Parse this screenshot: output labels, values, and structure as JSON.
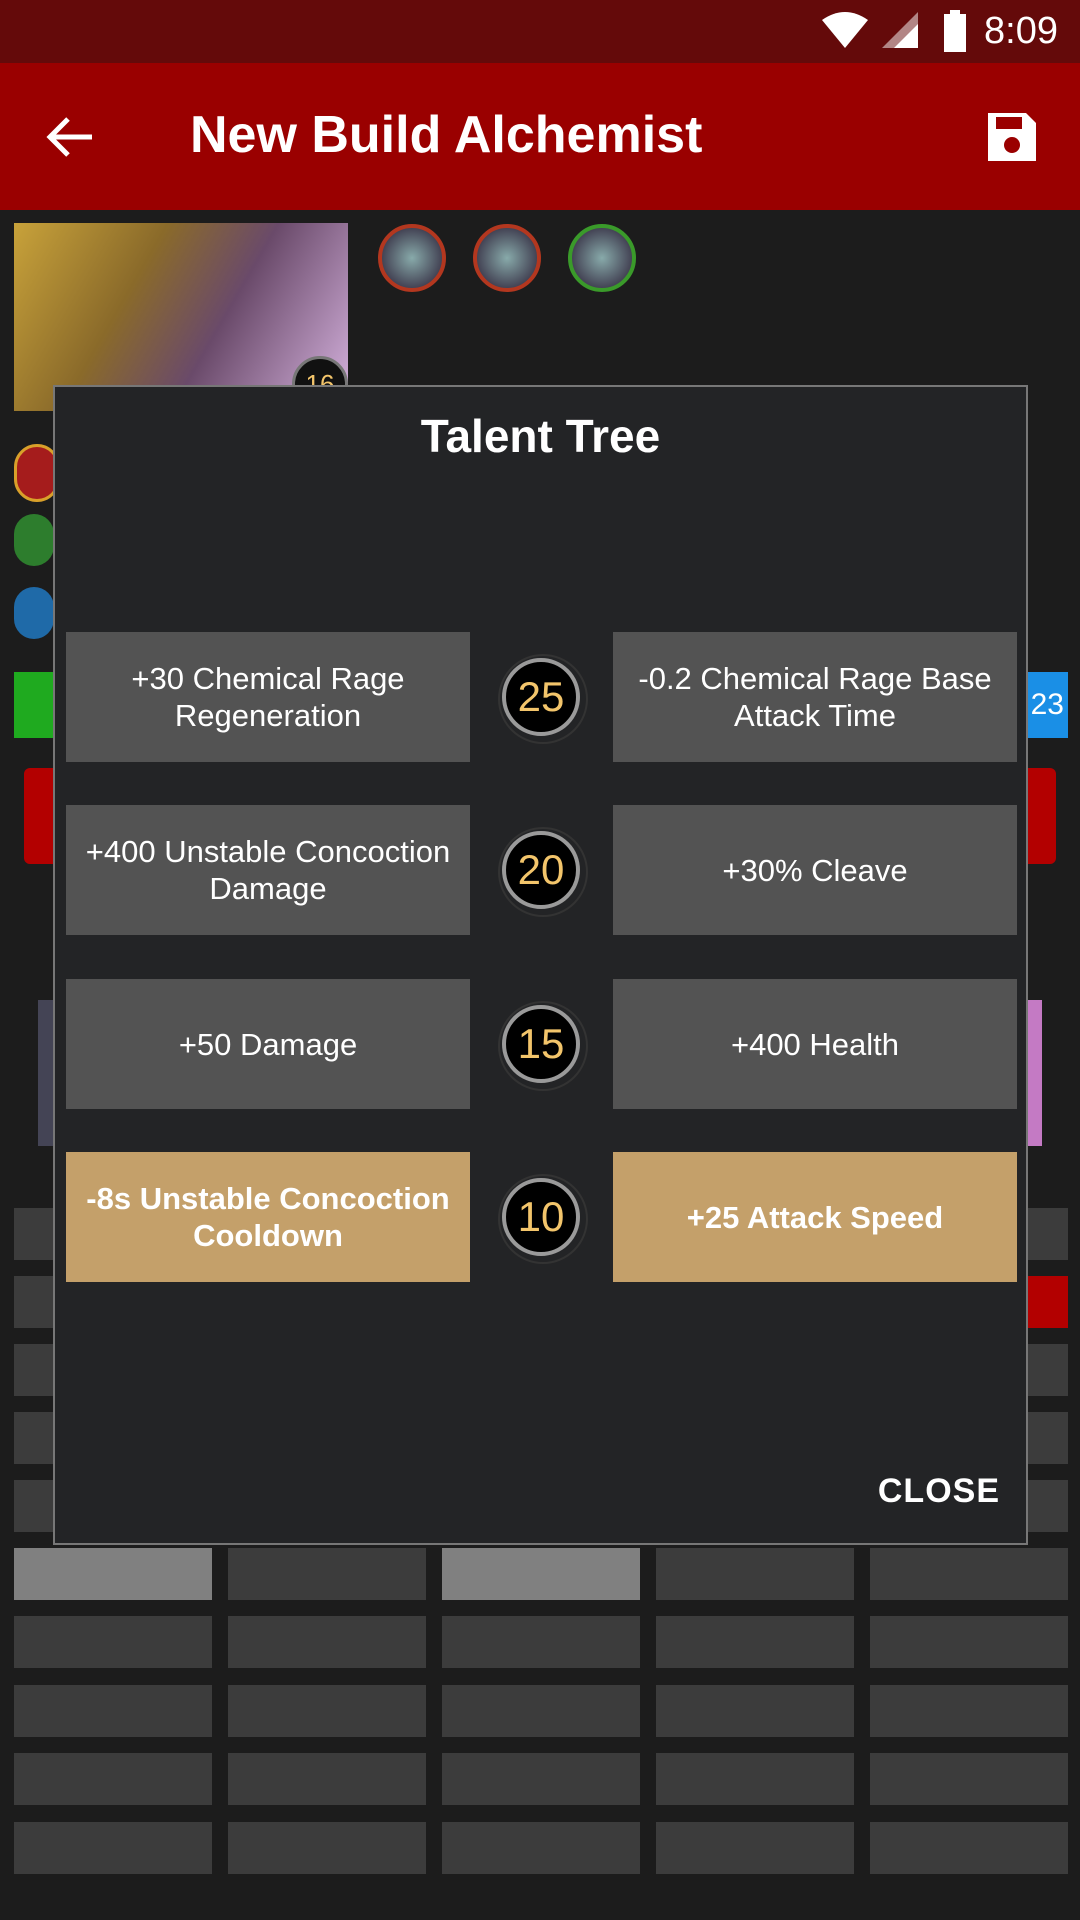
{
  "status_bar": {
    "time": "8:09"
  },
  "app_bar": {
    "title": "New Build Alchemist"
  },
  "hero": {
    "level": "16"
  },
  "background": {
    "blue_bar_text": "23"
  },
  "dialog": {
    "title": "Talent Tree",
    "close_label": "CLOSE",
    "rows": [
      {
        "level": "25",
        "left": "+30 Chemical Rage Regeneration",
        "right": "-0.2 Chemical Rage Base Attack Time",
        "selected": "none"
      },
      {
        "level": "20",
        "left": "+400 Unstable Concoction Damage",
        "right": "+30% Cleave",
        "selected": "none"
      },
      {
        "level": "15",
        "left": "+50 Damage",
        "right": "+400 Health",
        "selected": "none"
      },
      {
        "level": "10",
        "left": "-8s Unstable Concoction Cooldown",
        "right": "+25 Attack Speed",
        "selected": "both"
      }
    ]
  },
  "colors": {
    "app_bar": "#9a0000",
    "status_bar": "#640a0a",
    "talent_default": "#535353",
    "talent_selected": "#c4a06a",
    "level_text": "#f3c56b"
  }
}
